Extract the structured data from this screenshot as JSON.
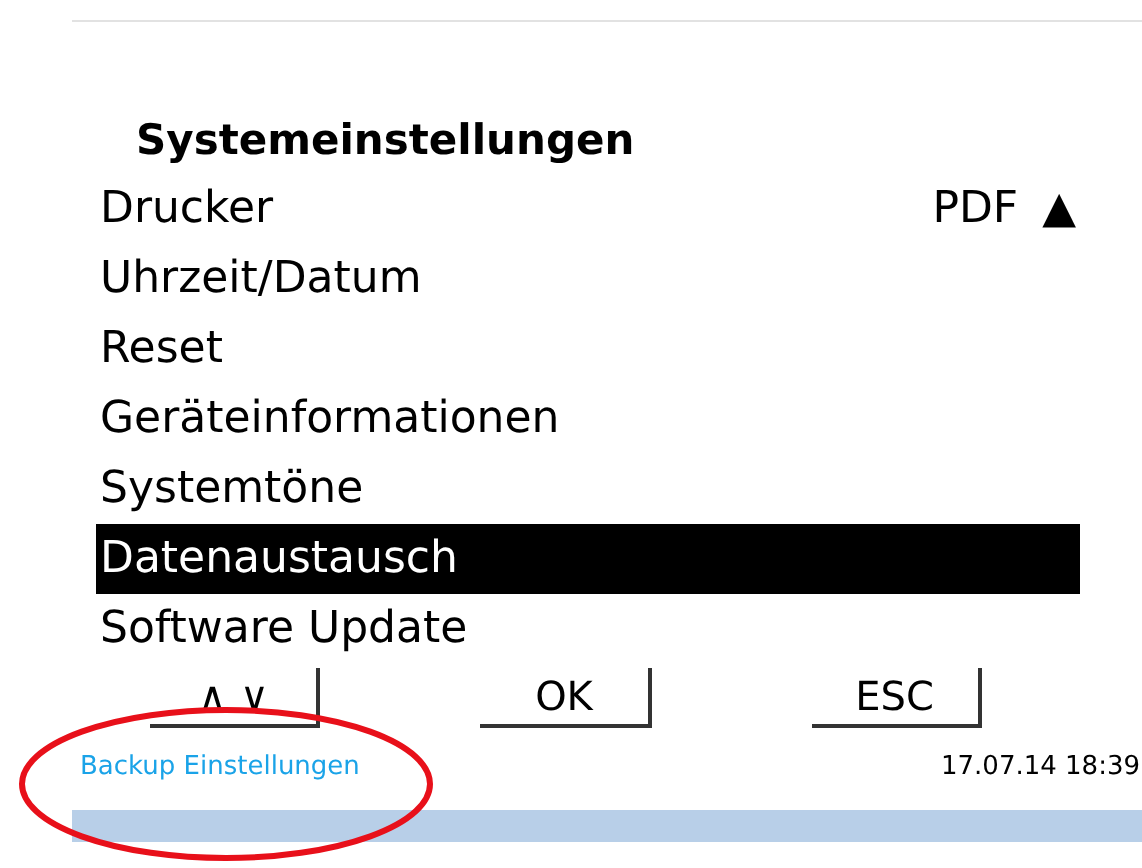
{
  "title": "Systemeinstellungen",
  "items": [
    {
      "label": "Drucker",
      "value": "PDF",
      "indicator": "▲",
      "selected": false
    },
    {
      "label": "Uhrzeit/Datum",
      "selected": false
    },
    {
      "label": "Reset",
      "selected": false
    },
    {
      "label": "Geräteinformationen",
      "selected": false
    },
    {
      "label": "Systemtöne",
      "selected": false
    },
    {
      "label": "Datenaustausch",
      "selected": true
    },
    {
      "label": "Software Update",
      "selected": false
    }
  ],
  "buttons": [
    "∧ ∨",
    "OK",
    "ESC"
  ],
  "footer": {
    "link": "Backup Einstellungen",
    "datetime": "17.07.14 18:39",
    "highlighted": true
  }
}
